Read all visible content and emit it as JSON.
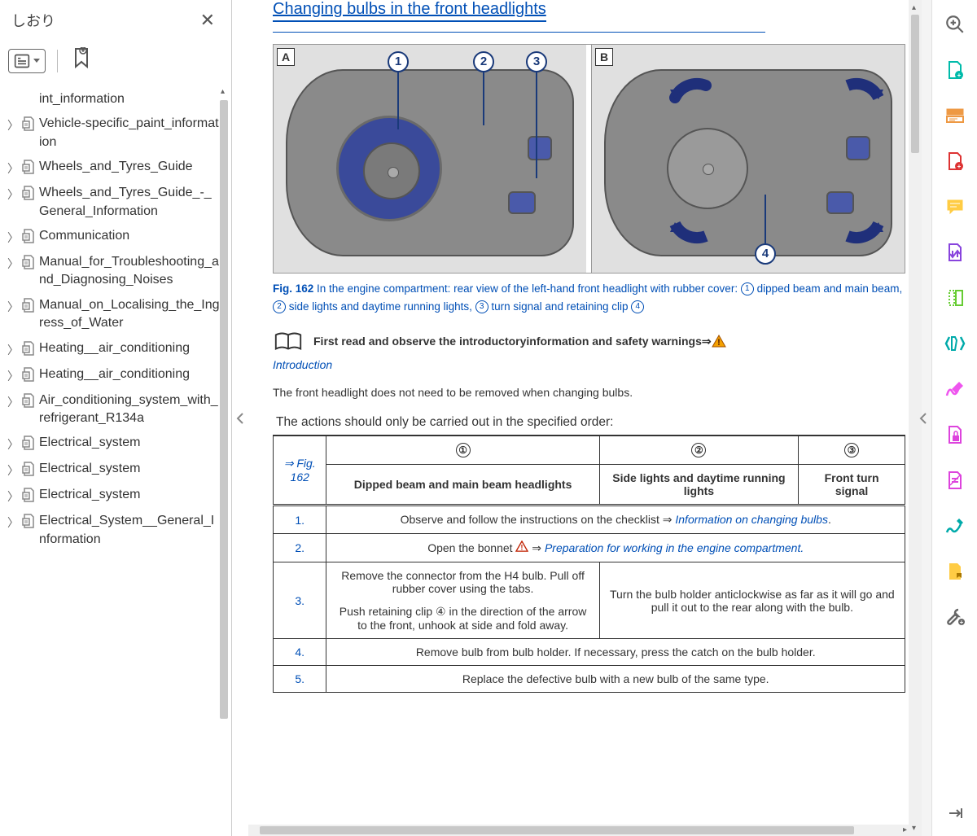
{
  "sidebar": {
    "title": "しおり",
    "items": [
      {
        "label": "int_information",
        "expandable": false
      },
      {
        "label": "Vehicle-specific_paint_information",
        "expandable": true
      },
      {
        "label": "Wheels_and_Tyres_Guide",
        "expandable": true
      },
      {
        "label": "Wheels_and_Tyres_Guide_-_General_Information",
        "expandable": true
      },
      {
        "label": "Communication",
        "expandable": true
      },
      {
        "label": "Manual_for_Troubleshooting_and_Diagnosing_Noises",
        "expandable": true
      },
      {
        "label": "Manual_on_Localising_the_Ingress_of_Water",
        "expandable": true
      },
      {
        "label": "Heating__air_conditioning",
        "expandable": true
      },
      {
        "label": "Heating__air_conditioning",
        "expandable": true
      },
      {
        "label": "Air_conditioning_system_with_refrigerant_R134a",
        "expandable": true
      },
      {
        "label": "Electrical_system",
        "expandable": true
      },
      {
        "label": "Electrical_system",
        "expandable": true
      },
      {
        "label": "Electrical_system",
        "expandable": true
      },
      {
        "label": "Electrical_System__General_Information",
        "expandable": true
      }
    ]
  },
  "doc": {
    "title": "Changing bulbs in the front headlights",
    "figure": {
      "labelA": "A",
      "labelB": "B",
      "num1": "1",
      "num2": "2",
      "num3": "3",
      "num4": "4",
      "caption_prefix": "Fig. 162",
      "caption_body_1": " In the engine compartment: rear view of the left-hand front headlight with rubber cover: ",
      "caption_c1": "1",
      "caption_part2": " dipped beam and main beam, ",
      "caption_c2": "2",
      "caption_part3": " side lights and daytime running lights, ",
      "caption_c3": "3",
      "caption_part4": " turn signal and retaining clip ",
      "caption_c4": "4"
    },
    "read_first": "First read and observe the introductoryinformation and safety warnings⇒",
    "intro_link": "Introduction",
    "body1": "The front headlight does not need to be removed when changing bulbs.",
    "table_title": "The actions should only be carried out in the specified order:",
    "table": {
      "hdr_fig": "⇒ Fig. 162",
      "hc1": "①",
      "hc2": "②",
      "hc3": "③",
      "col1": "Dipped beam and main beam headlights",
      "col2": "Side lights and daytime running lights",
      "col3": "Front turn signal",
      "r1_n": "1.",
      "r1_a": "Observe and follow the instructions on the checklist ⇒ ",
      "r1_b": "Information on changing bulbs",
      "r1_c": ".",
      "r2_n": "2.",
      "r2_a": "Open the bonnet ",
      "r2_b": " ⇒ ",
      "r2_c": "Preparation for working in the engine compartment.",
      "r3_n": "3.",
      "r3_c1a": "Remove the connector from the H4 bulb. Pull off rubber cover using the tabs.",
      "r3_c1b": "Push retaining clip ④ in the direction of the arrow to the front, unhook at side and fold away.",
      "r3_c2": "Turn the bulb holder anticlockwise as far as it will go and pull it out to the rear along with the bulb.",
      "r4_n": "4.",
      "r4": "Remove bulb from bulb holder. If necessary, press the catch on the bulb holder.",
      "r5_n": "5.",
      "r5": "Replace the defective bulb with a new bulb of the same type."
    }
  }
}
